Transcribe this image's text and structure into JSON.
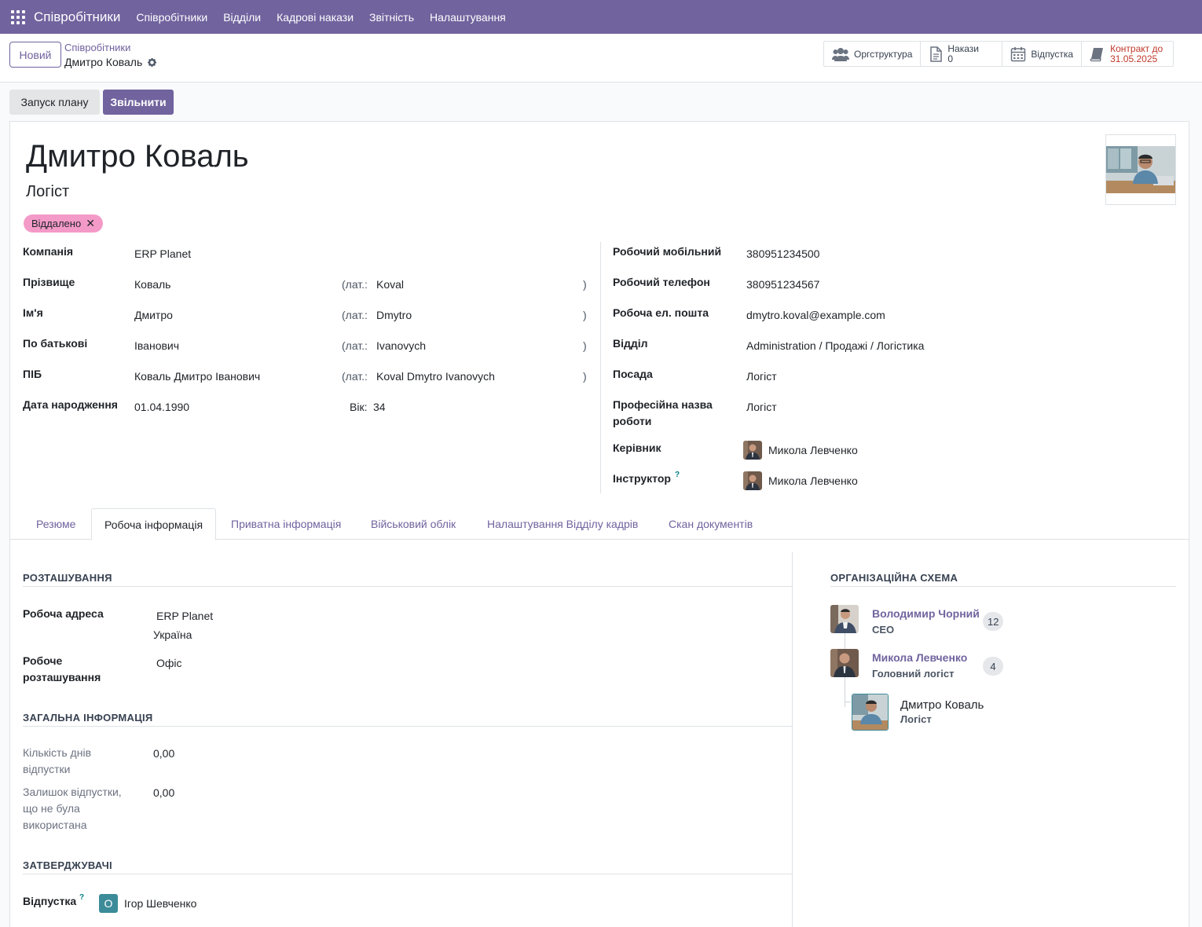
{
  "topnav": {
    "brand": "Співробітники",
    "items": [
      "Співробітники",
      "Відділи",
      "Кадрові накази",
      "Звітність",
      "Налаштування"
    ]
  },
  "cpanel": {
    "new_label": "Новий",
    "breadcrumb_parent": "Співробітники",
    "breadcrumb_current": "Дмитро Коваль",
    "smart": {
      "org": "Оргструктура",
      "orders_label": "Накази",
      "orders_count": "0",
      "leave": "Відпустка",
      "contract_label": "Контракт до",
      "contract_date": "31.05.2025"
    }
  },
  "actions": {
    "plan": "Запуск плану",
    "fire": "Звільнити"
  },
  "employee": {
    "name": "Дмитро Коваль",
    "job": "Логіст",
    "tag": "Віддалено"
  },
  "left_fields": {
    "company_label": "Компанія",
    "company": "ERP Planet",
    "lastname_label": "Прізвище",
    "lastname": "Коваль",
    "lastname_lat": "Koval",
    "firstname_label": "Ім'я",
    "firstname": "Дмитро",
    "firstname_lat": "Dmytro",
    "patronymic_label": "По батькові",
    "patronymic": "Іванович",
    "patronymic_lat": "Ivanovych",
    "fullname_label": "ПІБ",
    "fullname": "Коваль Дмитро Іванович",
    "fullname_lat": "Koval Dmytro Ivanovych",
    "lat_prefix": "(лат.:",
    "lat_suffix": ")",
    "birth_label": "Дата народження",
    "birth": "01.04.1990",
    "age_label": "Вік:",
    "age": "34"
  },
  "right_fields": {
    "mobile_label": "Робочий мобільний",
    "mobile": "380951234500",
    "phone_label": "Робочий телефон",
    "phone": "380951234567",
    "email_label": "Робоча ел. пошта",
    "email": "dmytro.koval@example.com",
    "dept_label": "Відділ",
    "dept": "Administration / Продажі / Логістика",
    "position_label": "Посада",
    "position": "Логіст",
    "prof_label_1": "Професійна назва",
    "prof_label_2": "роботи",
    "prof": "Логіст",
    "manager_label": "Керівник",
    "manager": "Микола Левченко",
    "coach_label": "Інструктор",
    "coach": "Микола Левченко",
    "help": "?"
  },
  "tabs": [
    "Резюме",
    "Робоча інформація",
    "Приватна інформація",
    "Військовий облік",
    "Налаштування Відділу кадрів",
    "Скан документів"
  ],
  "work": {
    "location_title": "РОЗТАШУВАННЯ",
    "address_label": "Робоча адреса",
    "address_1": "ERP Planet",
    "address_2": "Україна",
    "worklocation_label_1": "Робоче",
    "worklocation_label_2": "розташування",
    "worklocation": "Офіс",
    "general_title": "ЗАГАЛЬНА ІНФОРМАЦІЯ",
    "leave_days_label_1": "Кількість днів",
    "leave_days_label_2": "відпустки",
    "leave_days": "0,00",
    "leave_rest_label_1": "Залишок відпустки,",
    "leave_rest_label_2": "що не була",
    "leave_rest_label_3": "використана",
    "leave_rest": "0,00",
    "approvers_title": "ЗАТВЕРДЖУВАЧІ",
    "approver_leave_label": "Відпустка",
    "approver_initial": "О",
    "approver_name": "Ігор Шевченко"
  },
  "org": {
    "title": "ОРГАНІЗАЦІЙНА СХЕМА",
    "nodes": [
      {
        "name": "Володимир Чорний",
        "title": "CEO",
        "count": "12"
      },
      {
        "name": "Микола Левченко",
        "title": "Головний логіст",
        "count": "4"
      },
      {
        "name": "Дмитро Коваль",
        "title": "Логіст"
      }
    ]
  },
  "colors": {
    "brand": "#71639e",
    "tag": "#f49ac8",
    "contract": "#c0392b",
    "approver_badge": "#3c8b99"
  }
}
